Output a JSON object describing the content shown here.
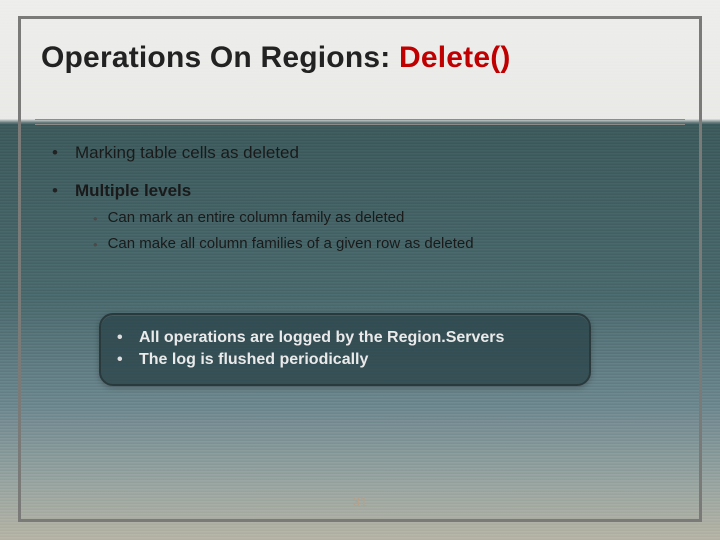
{
  "title": {
    "prefix": "Operations On Regions: ",
    "accent": "Delete()"
  },
  "bullets": {
    "items": [
      {
        "text": "Marking table cells as deleted",
        "bold": false,
        "sub": []
      },
      {
        "text": "Multiple levels",
        "bold": true,
        "sub": [
          "Can mark an entire column family as deleted",
          "Can make all column families of a given row as deleted"
        ]
      }
    ]
  },
  "callout": {
    "lines": [
      "All operations are logged by the Region.Servers",
      "The log is flushed periodically"
    ]
  },
  "slide_number": "31",
  "bullet_glyph": "•"
}
